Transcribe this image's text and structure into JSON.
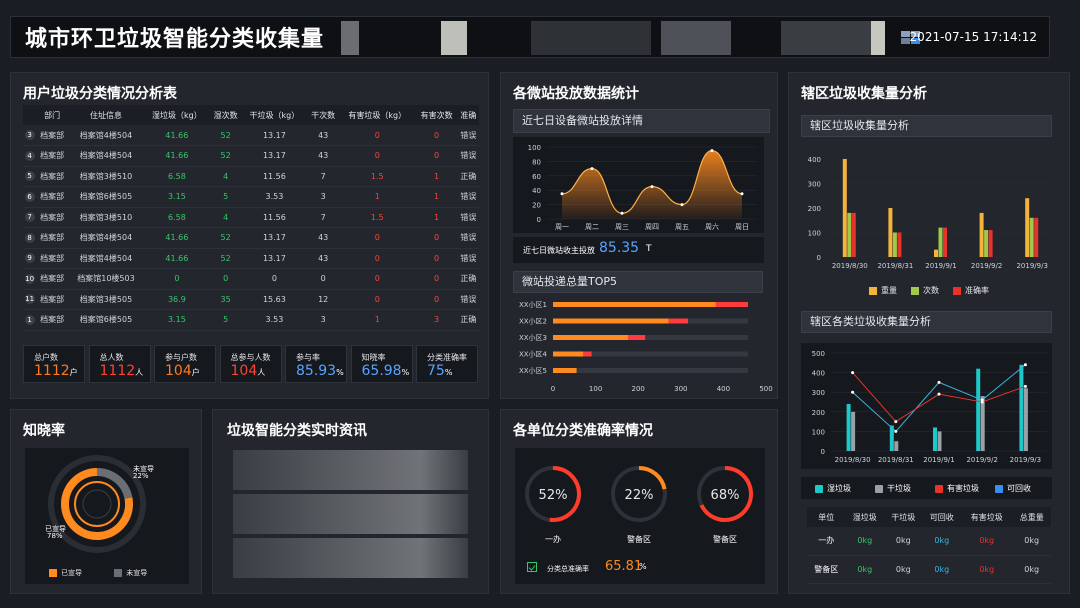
{
  "header": {
    "title": "城市环卫垃圾智能分类收集量",
    "datetime": "2021-07-15  17:14:12"
  },
  "table_panel": {
    "title": "用户垃圾分类情况分析表",
    "columns": [
      "部门",
      "住址信息",
      "湿垃圾（kg）",
      "湿次数",
      "干垃圾（kg）",
      "干次数",
      "有害垃圾（kg）",
      "有害次数",
      "准确"
    ],
    "rows": [
      [
        "3",
        "档案部",
        "档案馆4楼504",
        "41.66",
        "52",
        "13.17",
        "43",
        "0",
        "0",
        "错误"
      ],
      [
        "4",
        "档案部",
        "档案馆4楼504",
        "41.66",
        "52",
        "13.17",
        "43",
        "0",
        "0",
        "错误"
      ],
      [
        "5",
        "档案部",
        "档案馆3楼510",
        "6.58",
        "4",
        "11.56",
        "7",
        "1.5",
        "1",
        "正确"
      ],
      [
        "6",
        "档案部",
        "档案馆6楼505",
        "3.15",
        "5",
        "3.53",
        "3",
        "1",
        "1",
        "错误"
      ],
      [
        "7",
        "档案部",
        "档案馆3楼510",
        "6.58",
        "4",
        "11.56",
        "7",
        "1.5",
        "1",
        "错误"
      ],
      [
        "8",
        "档案部",
        "档案馆4楼504",
        "41.66",
        "52",
        "13.17",
        "43",
        "0",
        "0",
        "错误"
      ],
      [
        "9",
        "档案部",
        "档案馆4楼504",
        "41.66",
        "52",
        "13.17",
        "43",
        "0",
        "0",
        "错误"
      ],
      [
        "10",
        "档案部",
        "档案馆10楼503",
        "0",
        "0",
        "0",
        "0",
        "0",
        "0",
        "正确"
      ],
      [
        "11",
        "档案部",
        "档案馆3楼505",
        "36.9",
        "35",
        "15.63",
        "12",
        "0",
        "0",
        "错误"
      ],
      [
        "1",
        "档案部",
        "档案馆6楼505",
        "3.15",
        "5",
        "3.53",
        "3",
        "1",
        "3",
        "正确"
      ]
    ],
    "stats": [
      {
        "label": "总户数",
        "value": "1112",
        "unit": "户",
        "color": "#ff7a1f"
      },
      {
        "label": "总人数",
        "value": "1112",
        "unit": "人",
        "color": "#ff4133"
      },
      {
        "label": "参与户数",
        "value": "104",
        "unit": "户",
        "color": "#ff7a1f"
      },
      {
        "label": "总参与人数",
        "value": "104",
        "unit": "人",
        "color": "#ff4133"
      },
      {
        "label": "参与率",
        "value": "85.93",
        "unit": "%",
        "color": "#5aa3ff"
      },
      {
        "label": "知晓率",
        "value": "65.98",
        "unit": "%",
        "color": "#5aa3ff"
      },
      {
        "label": "分类准确率",
        "value": "75",
        "unit": "%",
        "color": "#5aa3ff"
      }
    ]
  },
  "station_panel": {
    "title": "各微站投放数据统计",
    "sub1": "近七日设备微站投放详情",
    "line": {
      "x": [
        "周一",
        "周二",
        "周三",
        "周四",
        "周五",
        "周六",
        "周日"
      ],
      "values": [
        35,
        70,
        8,
        45,
        20,
        95,
        35
      ],
      "yticks": [
        "100",
        "80",
        "60",
        "40",
        "20",
        "0"
      ]
    },
    "total_label": "近七日微站收主投放",
    "total_value": "85.35",
    "total_unit": "T",
    "sub2": "微站投递总量TOP5",
    "bars": {
      "categories": [
        "XX小区1",
        "XX小区2",
        "XX小区3",
        "XX小区4",
        "XX小区5"
      ],
      "seg1": [
        380,
        270,
        175,
        70,
        55
      ],
      "seg2": [
        75,
        45,
        40,
        20,
        0
      ],
      "xticks": [
        "0",
        "100",
        "200",
        "300",
        "400",
        "500"
      ]
    }
  },
  "district_panel": {
    "title": "辖区垃圾收集量分析",
    "sub1": "辖区垃圾收集量分析",
    "bar_chart": {
      "x": [
        "2019/8/30",
        "2019/8/31",
        "2019/9/1",
        "2019/9/2",
        "2019/9/3"
      ],
      "series": [
        {
          "name": "重量",
          "values": [
            400,
            200,
            30,
            180,
            240
          ],
          "color": "#f4b33a"
        },
        {
          "name": "次数",
          "values": [
            180,
            100,
            120,
            110,
            160
          ],
          "color": "#a0c94a"
        },
        {
          "name": "准确率",
          "values": [
            180,
            100,
            120,
            110,
            160
          ],
          "color": "#e8322b"
        }
      ],
      "yticks": [
        "400",
        "300",
        "200",
        "100",
        "0"
      ]
    },
    "sub2": "辖区各类垃圾收集量分析",
    "combo": {
      "x": [
        "2019/8/30",
        "2019/8/31",
        "2019/9/1",
        "2019/9/2",
        "2019/9/3"
      ],
      "bars": [
        [
          240,
          130,
          120,
          420,
          440
        ],
        [
          200,
          50,
          100,
          280,
          320
        ]
      ],
      "line1": [
        300,
        100,
        350,
        260,
        440
      ],
      "line2": [
        400,
        150,
        290,
        250,
        330
      ],
      "yticks": [
        "500",
        "400",
        "300",
        "200",
        "100",
        "0"
      ]
    },
    "legend": [
      {
        "name": "湿垃圾",
        "color": "#1ec8c8"
      },
      {
        "name": "干垃圾",
        "color": "#9aa0a8"
      },
      {
        "name": "有害垃圾",
        "color": "#e8322b"
      },
      {
        "name": "可回收",
        "color": "#3a8ef0"
      }
    ],
    "unit_table": {
      "columns": [
        "单位",
        "湿垃圾",
        "干垃圾",
        "可回收",
        "有害垃圾",
        "总重量"
      ],
      "rows": [
        [
          "一办",
          "0kg",
          "0kg",
          "0kg",
          "0kg",
          "0kg"
        ],
        [
          "警备区",
          "0kg",
          "0kg",
          "0kg",
          "0kg",
          "0kg"
        ]
      ]
    }
  },
  "aware_panel": {
    "title": "知晓率",
    "label_no": "未宣导",
    "pct_no": "22%",
    "label_yes": "已宣导",
    "pct_yes": "78%",
    "legend_yes": "已宣导",
    "legend_no": "未宣导",
    "yes_value": 78,
    "no_value": 22
  },
  "news_panel": {
    "title": "垃圾智能分类实时资讯"
  },
  "accuracy_panel": {
    "title": "各单位分类准确率情况",
    "gauges": [
      {
        "name": "一办",
        "value": 52,
        "label": "52%"
      },
      {
        "name": "警备区",
        "value": 22,
        "label": "22%"
      },
      {
        "name": "警备区",
        "value": 68,
        "label": "68%"
      }
    ],
    "total_label": "分类总准确率",
    "total_value": "65.81",
    "total_unit": "%"
  }
}
